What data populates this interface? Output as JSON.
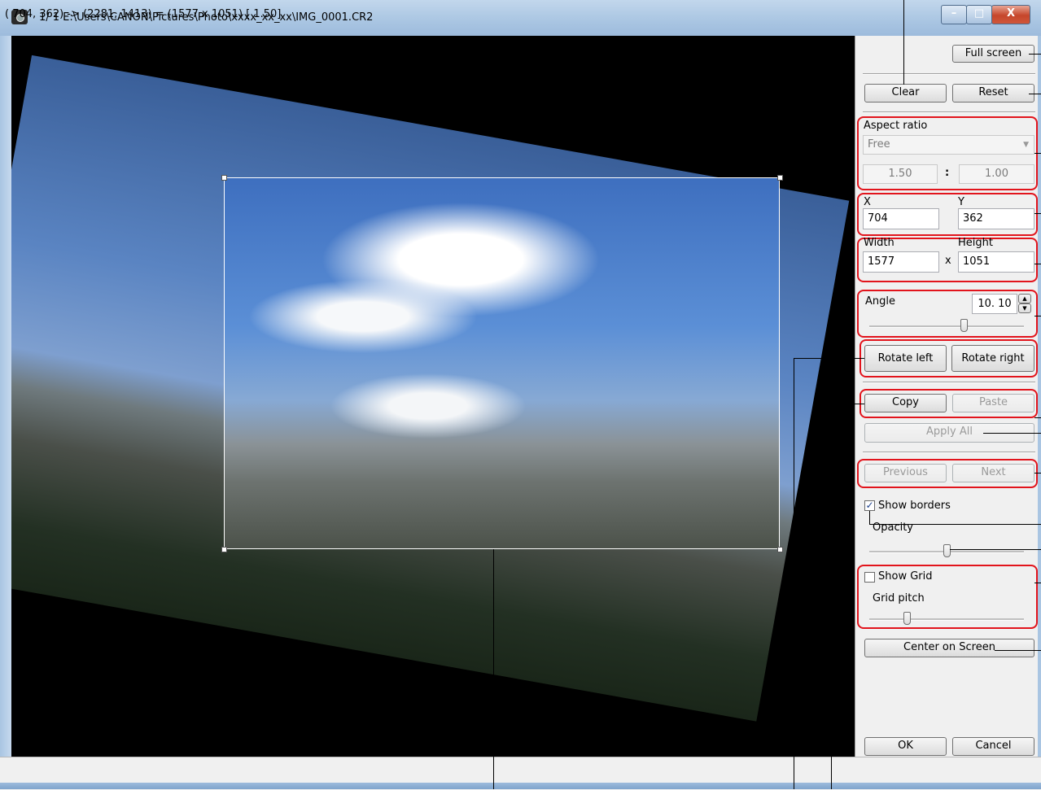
{
  "window": {
    "title": "1/  1  E:\\Users\\CANON\\Pictures\\Photo\\xxxx_xx_xx\\IMG_0001.CR2",
    "controls": {
      "minimize": "–",
      "maximize": "□",
      "close": "X"
    }
  },
  "status_bar": {
    "text": "( 704,  362) -> (2281, 1413) = (1577 x 1051) [ 1.50]"
  },
  "panel": {
    "full_screen": "Full screen",
    "clear": "Clear",
    "reset": "Reset",
    "aspect_ratio": {
      "label": "Aspect ratio",
      "selected": "Free",
      "ratio_left": "1.50",
      "ratio_sep": ":",
      "ratio_right": "1.00"
    },
    "position": {
      "x_label": "X",
      "x_value": "704",
      "y_label": "Y",
      "y_value": "362"
    },
    "size": {
      "width_label": "Width",
      "width_value": "1577",
      "times": "x",
      "height_label": "Height",
      "height_value": "1051"
    },
    "angle": {
      "label": "Angle",
      "value": "10. 10"
    },
    "rotate_left": "Rotate left",
    "rotate_right": "Rotate right",
    "copy": "Copy",
    "paste": "Paste",
    "apply_all": "Apply All",
    "previous": "Previous",
    "next": "Next",
    "show_borders": {
      "label": "Show borders",
      "checked": true,
      "mark": "✓"
    },
    "opacity_label": "Opacity",
    "show_grid": {
      "label": "Show Grid",
      "checked": false
    },
    "grid_pitch_label": "Grid pitch",
    "center_on_screen": "Center on Screen",
    "ok": "OK",
    "cancel": "Cancel"
  },
  "colors": {
    "highlight": "#e2141c",
    "sky": "#5b8fd6"
  }
}
